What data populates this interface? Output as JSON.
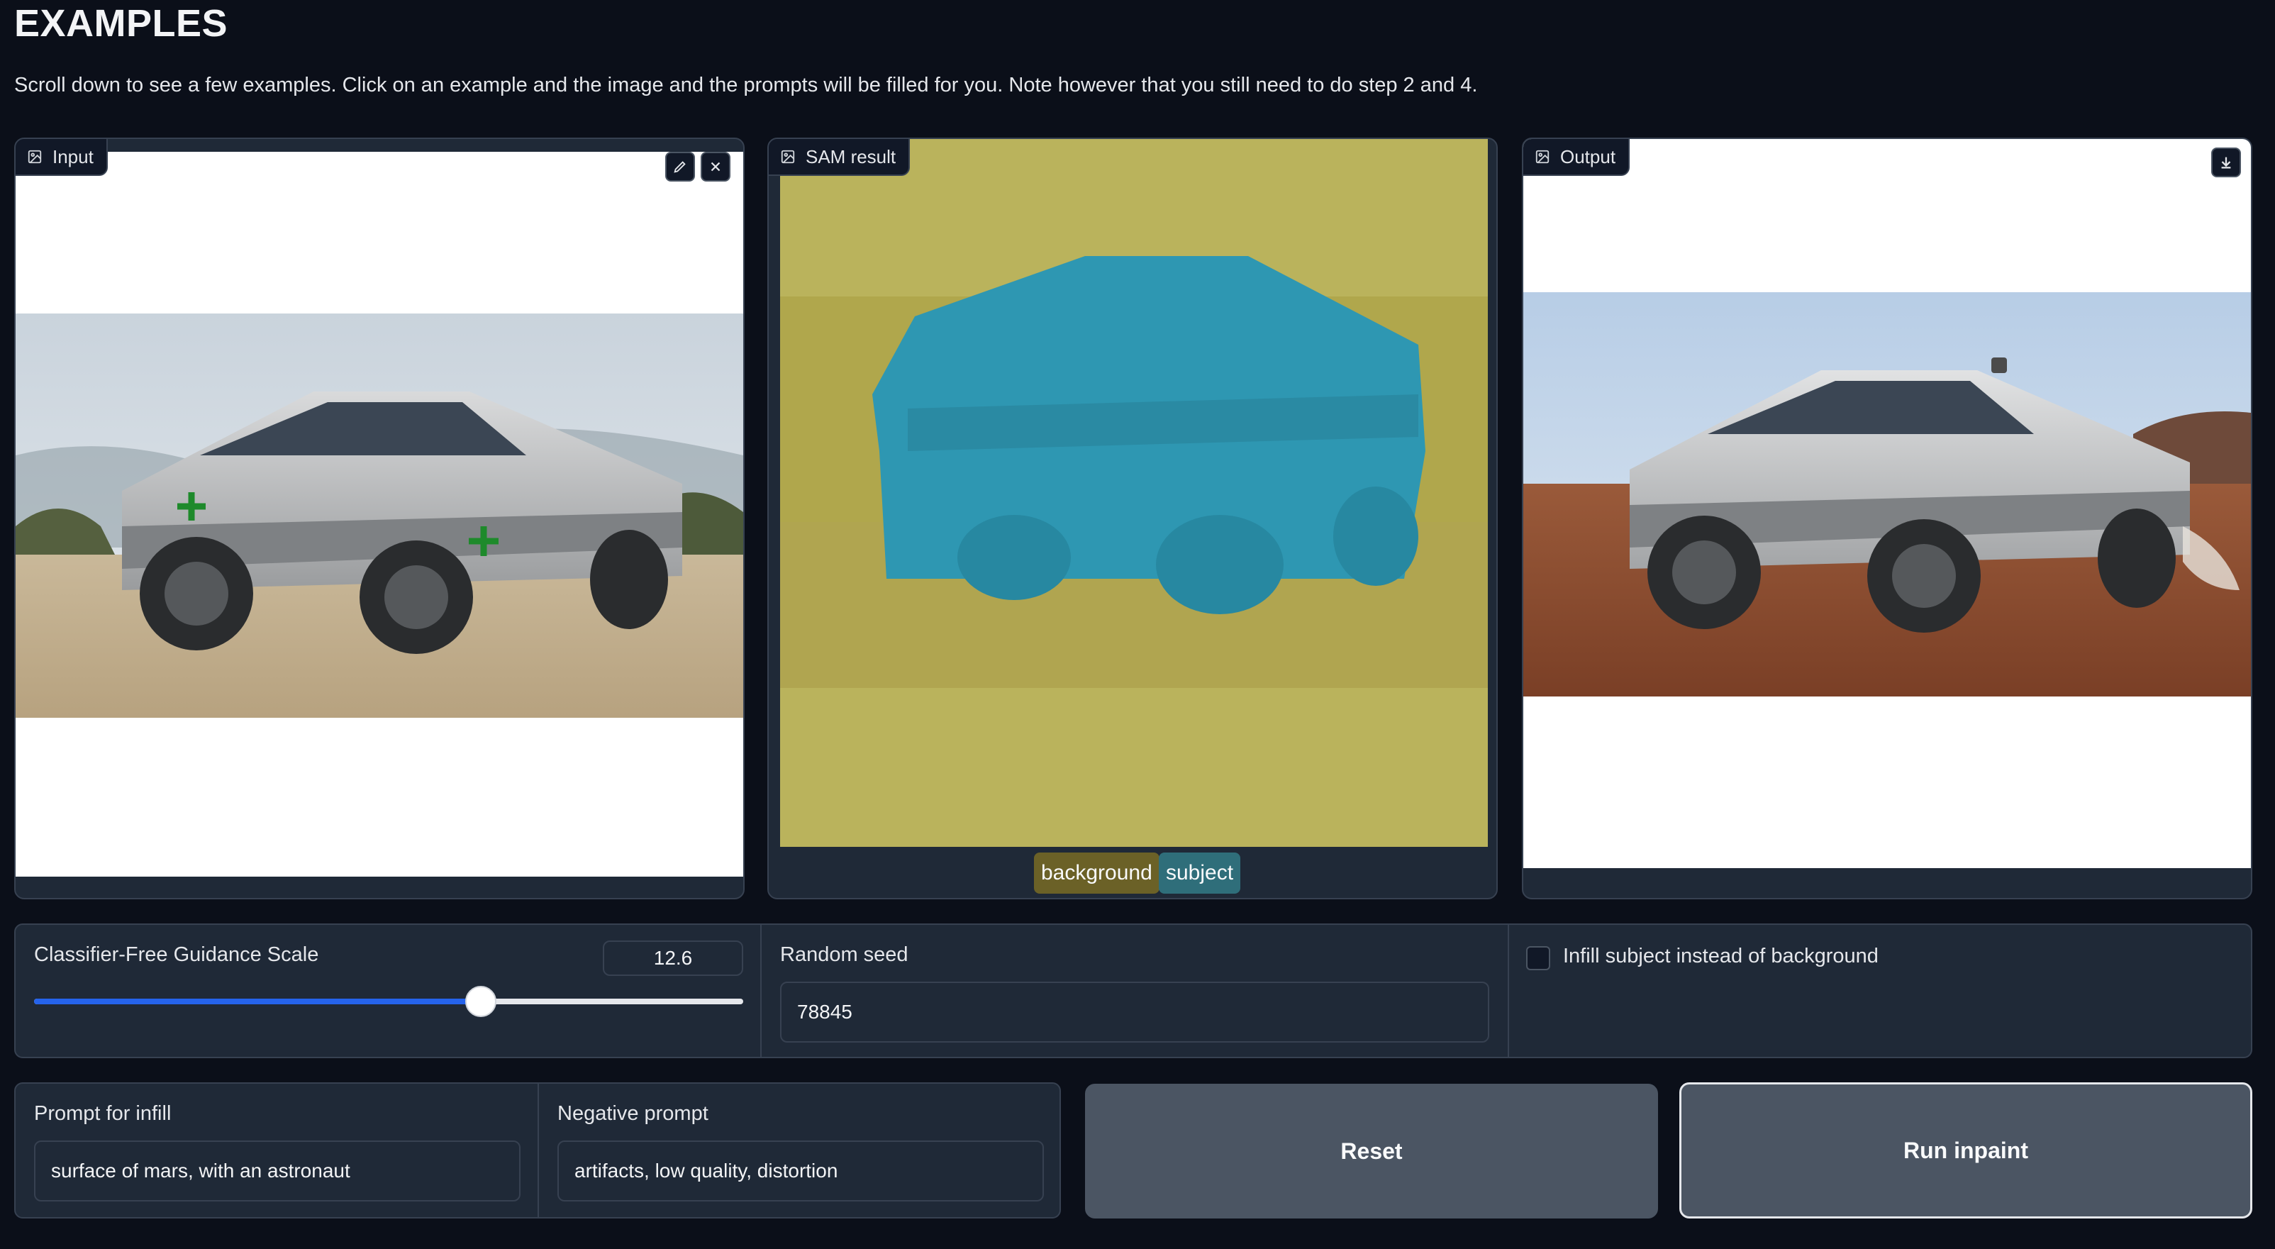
{
  "header": {
    "title": "EXAMPLES",
    "description": "Scroll down to see a few examples. Click on an example and the image and the prompts will be filled for you. Note however that you still need to do step 2 and 4."
  },
  "panels": {
    "input": {
      "label": "Input",
      "icon": "image-icon"
    },
    "sam": {
      "label": "SAM result",
      "icon": "image-icon"
    },
    "output": {
      "label": "Output",
      "icon": "image-icon"
    }
  },
  "sam_legend": [
    {
      "label": "background",
      "color": "#6b6127"
    },
    {
      "label": "subject",
      "color": "#2f6e7a"
    }
  ],
  "controls": {
    "guidance": {
      "label": "Classifier-Free Guidance Scale",
      "value": "12.6",
      "fraction": 0.63
    },
    "seed": {
      "label": "Random seed",
      "value": "78845"
    },
    "infill_checkbox": {
      "label": "Infill subject instead of background",
      "checked": false
    }
  },
  "prompts": {
    "infill": {
      "label": "Prompt for infill",
      "value": "surface of mars, with an astronaut"
    },
    "negative": {
      "label": "Negative prompt",
      "value": "artifacts, low quality, distortion"
    }
  },
  "buttons": {
    "reset": "Reset",
    "run": "Run inpaint"
  },
  "colors": {
    "background": "#0b0f19",
    "panel": "#1f2937",
    "slider_accent": "#2563eb",
    "sam_background_overlay": "#bab35c",
    "sam_subject_overlay": "#2e97b2"
  }
}
